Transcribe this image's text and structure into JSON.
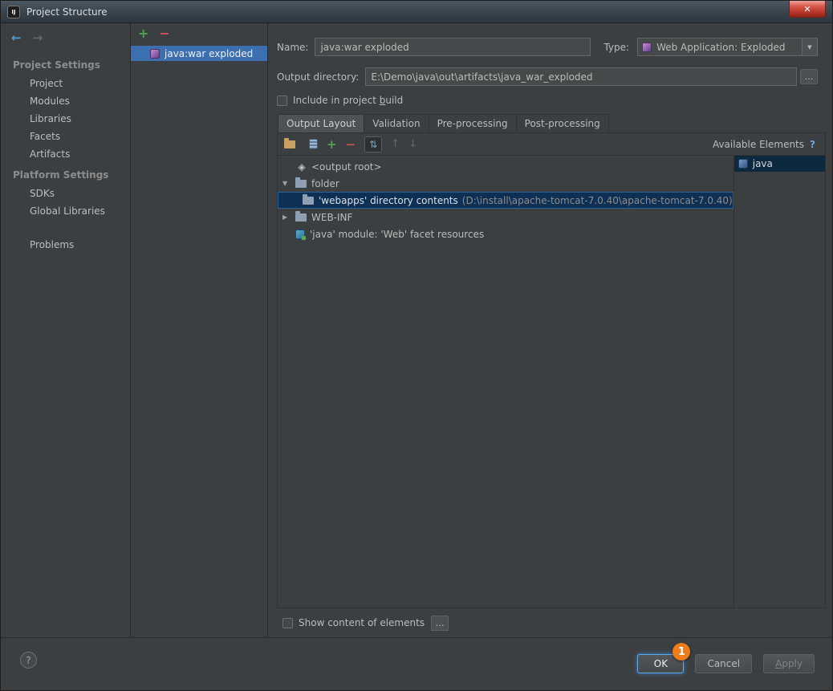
{
  "window": {
    "title": "Project Structure",
    "logo": "IJ"
  },
  "icons": {
    "close": "✕",
    "back": "←",
    "forward": "→",
    "add": "+",
    "remove": "−",
    "sort": "⇅",
    "up": "↑",
    "down": "↓",
    "dropdown_arrow": "▼",
    "expand": "▼",
    "collapse": "▶",
    "browse": "…",
    "help": "?",
    "output_root": "◈"
  },
  "sidebar": {
    "sections": [
      {
        "header": "Project Settings",
        "items": [
          "Project",
          "Modules",
          "Libraries",
          "Facets",
          "Artifacts"
        ]
      },
      {
        "header": "Platform Settings",
        "items": [
          "SDKs",
          "Global Libraries"
        ]
      },
      {
        "header": "",
        "items": [
          "Problems"
        ]
      }
    ]
  },
  "artifacts_list": {
    "items": [
      "java:war exploded"
    ]
  },
  "form": {
    "name_label": "Name:",
    "name_value": "java:war exploded",
    "type_label": "Type:",
    "type_value": "Web Application: Exploded",
    "output_label": "Output directory:",
    "output_value": "E:\\Demo\\java\\out\\artifacts\\java_war_exploded",
    "include_pre": "Include in project ",
    "include_mn": "b",
    "include_post": "uild"
  },
  "tabs": [
    "Output Layout",
    "Validation",
    "Pre-processing",
    "Post-processing"
  ],
  "available_panel": {
    "header": "Available Elements",
    "items": [
      "java"
    ]
  },
  "tree": {
    "rows": [
      {
        "label": "<output root>"
      },
      {
        "label": "folder"
      },
      {
        "label": "'webapps' directory contents",
        "path": "(D:\\install\\apache-tomcat-7.0.40\\apache-tomcat-7.0.40)"
      },
      {
        "label": "WEB-INF"
      },
      {
        "label": "'java' module: 'Web' facet resources"
      }
    ]
  },
  "bottom_bar": {
    "show_content_label": "Show content of elements"
  },
  "footer": {
    "ok": "OK",
    "cancel": "Cancel",
    "apply_mn": "A",
    "apply_rest": "pply",
    "badge": "1"
  }
}
